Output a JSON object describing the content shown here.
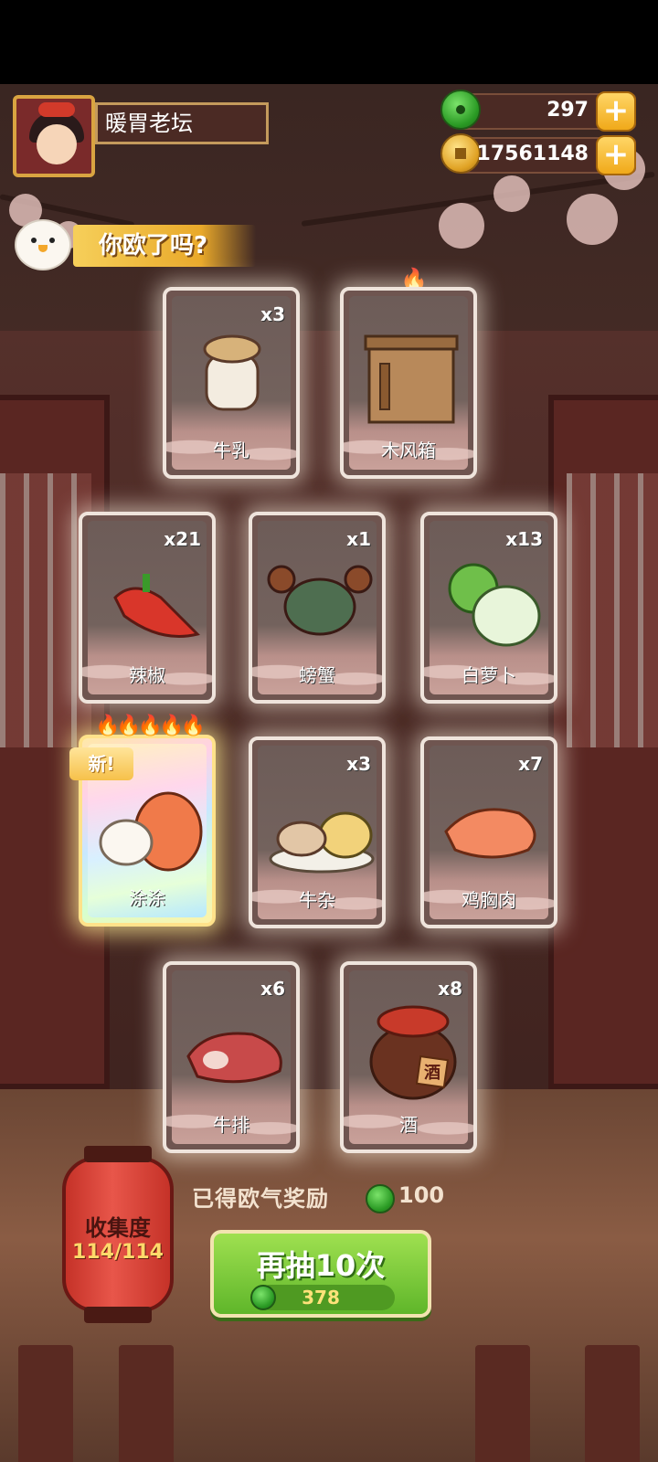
{
  "player": {
    "name": "暖胃老坛"
  },
  "resources": {
    "gems": {
      "value": "297",
      "icon": "green-jade-icon"
    },
    "coins": {
      "value": "17561148",
      "icon": "gold-coin-icon"
    },
    "plus_icon": "plus-icon"
  },
  "banner": {
    "text": "你欧了吗?"
  },
  "cards": [
    {
      "name": "牛乳",
      "count": "x3",
      "icon": "milk-jar-icon"
    },
    {
      "name": "木风箱",
      "count": "",
      "icon": "wooden-bellows-icon"
    },
    {
      "name": "辣椒",
      "count": "x21",
      "icon": "chili-pepper-icon"
    },
    {
      "name": "螃蟹",
      "count": "x1",
      "icon": "crab-icon"
    },
    {
      "name": "白萝卜",
      "count": "x13",
      "icon": "white-radish-icon"
    },
    {
      "name": "涂涂",
      "count": "",
      "icon": "fox-character-icon",
      "badge": "新!"
    },
    {
      "name": "牛杂",
      "count": "x3",
      "icon": "beef-offal-icon"
    },
    {
      "name": "鸡胸肉",
      "count": "x7",
      "icon": "chicken-breast-icon"
    },
    {
      "name": "牛排",
      "count": "x6",
      "icon": "steak-icon"
    },
    {
      "name": "酒",
      "count": "x8",
      "icon": "wine-jar-icon",
      "jar_text": "酒"
    }
  ],
  "collection": {
    "label": "收集度",
    "value": "114/114"
  },
  "reward": {
    "label": "已得欧气奖励",
    "value": "100"
  },
  "draw_button": {
    "label": "再抽10次",
    "cost": "378"
  },
  "colors": {
    "accent_green": "#6fc336",
    "gold": "#f0a91a",
    "card_bg": "#6f5550"
  }
}
